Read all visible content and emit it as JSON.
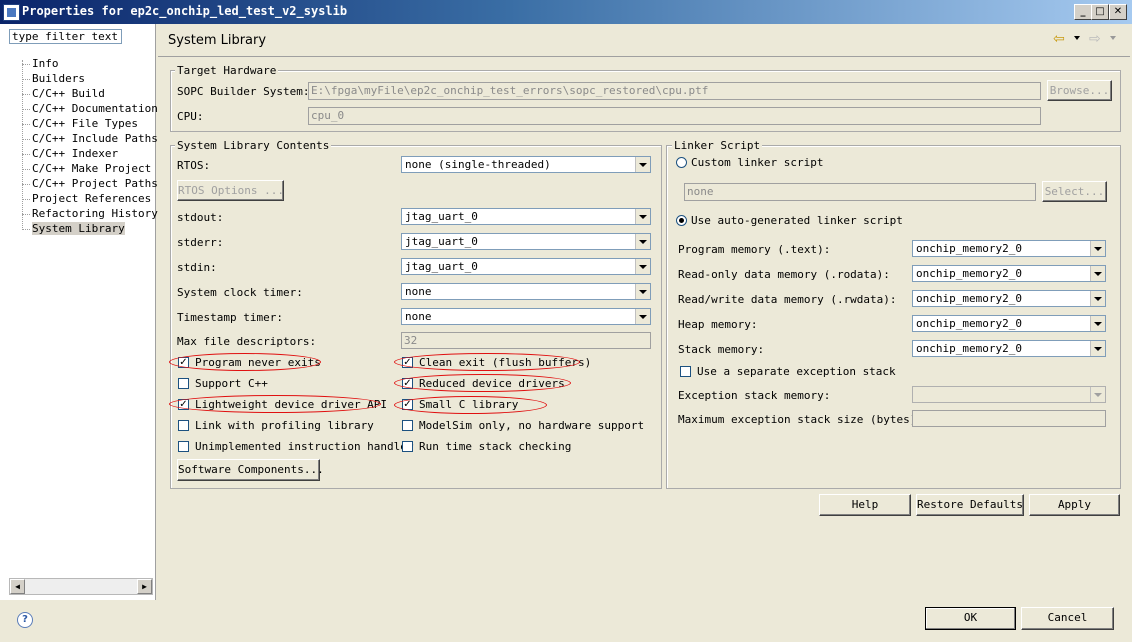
{
  "window": {
    "title": "Properties for ep2c_onchip_led_test_v2_syslib"
  },
  "filter": {
    "value": "type filter text"
  },
  "tree": [
    "Info",
    "Builders",
    "C/C++ Build",
    "C/C++ Documentation",
    "C/C++ File Types",
    "C/C++ Include Paths",
    "C/C++ Indexer",
    "C/C++ Make Project",
    "C/C++ Project Paths",
    "Project References",
    "Refactoring History",
    "System Library"
  ],
  "panel": {
    "title": "System Library"
  },
  "target": {
    "group_label": "Target Hardware",
    "sopc_label": "SOPC Builder System:",
    "sopc_value": "E:\\fpga\\myFile\\ep2c_onchip_test_errors\\sopc_restored\\cpu.ptf",
    "browse": "Browse...",
    "cpu_label": "CPU:",
    "cpu_value": "cpu_0"
  },
  "contents": {
    "group_label": "System Library Contents",
    "rtos_label": "RTOS:",
    "rtos_value": "none (single-threaded)",
    "rtos_options": "RTOS Options ...",
    "stdout_label": "stdout:",
    "stdout_value": "jtag_uart_0",
    "stderr_label": "stderr:",
    "stderr_value": "jtag_uart_0",
    "stdin_label": "stdin:",
    "stdin_value": "jtag_uart_0",
    "sysclk_label": "System clock timer:",
    "sysclk_value": "none",
    "timestamp_label": "Timestamp timer:",
    "timestamp_value": "none",
    "maxfd_label": "Max file descriptors:",
    "maxfd_value": "32",
    "checkboxes": [
      {
        "label": "Program never exits",
        "checked": true
      },
      {
        "label": "Clean exit (flush buffers)",
        "checked": true
      },
      {
        "label": "Support C++",
        "checked": false
      },
      {
        "label": "Reduced device drivers",
        "checked": true
      },
      {
        "label": "Lightweight device driver API",
        "checked": true
      },
      {
        "label": "Small C library",
        "checked": true
      },
      {
        "label": "Link with profiling library",
        "checked": false
      },
      {
        "label": "ModelSim only, no hardware support",
        "checked": false
      },
      {
        "label": "Unimplemented instruction handler",
        "checked": false
      },
      {
        "label": "Run time stack checking",
        "checked": false
      }
    ],
    "software_components": "Software Components..."
  },
  "linker": {
    "group_label": "Linker Script",
    "custom_label": "Custom linker script",
    "custom_value": "none",
    "select": "Select...",
    "auto_label": "Use auto-generated linker script",
    "program_label": "Program memory (.text):",
    "program_value": "onchip_memory2_0",
    "rodata_label": "Read-only data memory (.rodata):",
    "rodata_value": "onchip_memory2_0",
    "rwdata_label": "Read/write data memory (.rwdata):",
    "rwdata_value": "onchip_memory2_0",
    "heap_label": "Heap memory:",
    "heap_value": "onchip_memory2_0",
    "stack_label": "Stack memory:",
    "stack_value": "onchip_memory2_0",
    "sep_stack_label": "Use a separate exception stack",
    "exc_mem_label": "Exception stack memory:",
    "exc_size_label": "Maximum exception stack size (bytes):"
  },
  "actions": {
    "help": "Help",
    "restore": "Restore Defaults",
    "apply": "Apply",
    "ok": "OK",
    "cancel": "Cancel"
  },
  "colors": {
    "title_start": "#0a246a",
    "title_end": "#a6caf0",
    "annotation": "#e01010",
    "face": "#ece9d8"
  }
}
